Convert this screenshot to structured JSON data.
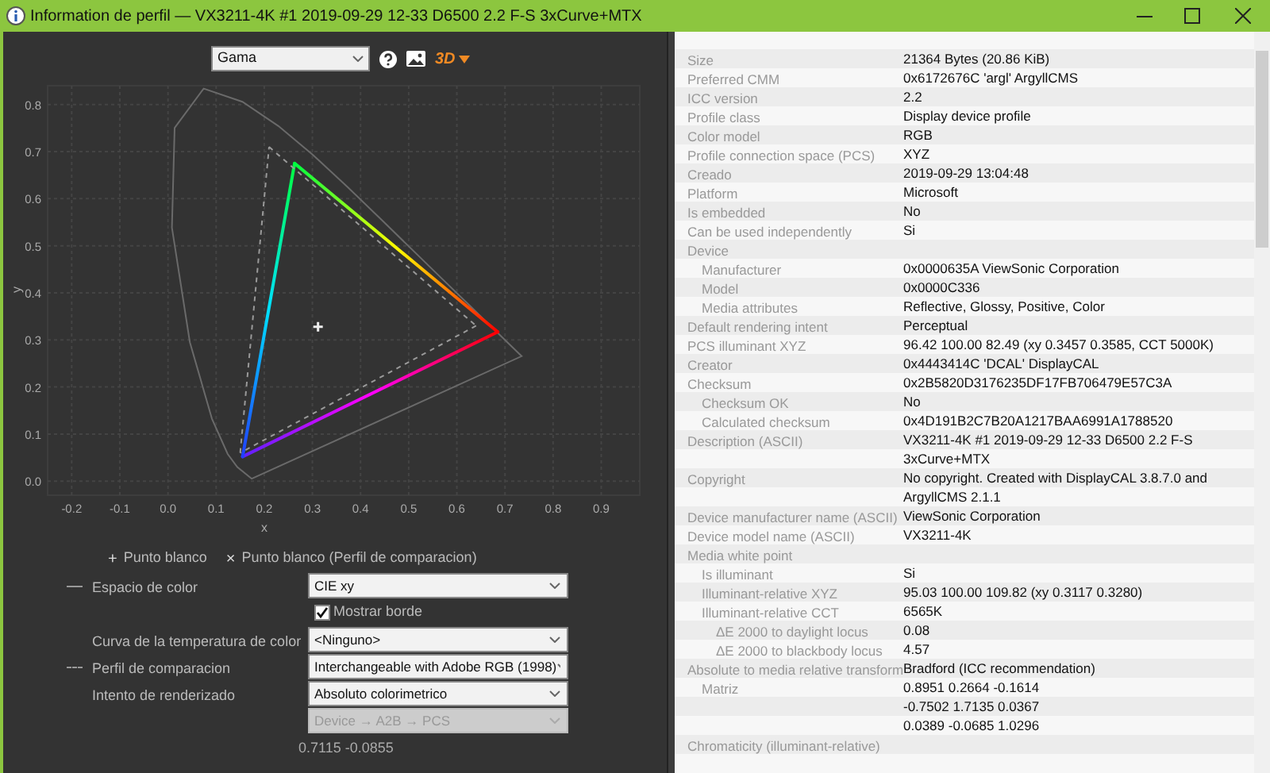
{
  "window": {
    "title": "Information de perfil — VX3211-4K #1 2019-09-29 12-33 D6500 2.2 F-S 3xCurve+MTX"
  },
  "toolbar": {
    "view_select": "Gama",
    "three_d_label": "3D"
  },
  "chart_data": {
    "type": "line",
    "xlabel": "x",
    "ylabel": "y",
    "xlim": [
      -0.25,
      0.98
    ],
    "ylim": [
      -0.03,
      0.84
    ],
    "xticks": [
      {
        "value": -0.2,
        "label": "-0.2"
      },
      {
        "value": -0.1,
        "label": "-0.1"
      },
      {
        "value": 0,
        "label": "0.0"
      },
      {
        "value": 0.1,
        "label": "0.1"
      },
      {
        "value": 0.2,
        "label": "0.2"
      },
      {
        "value": 0.3,
        "label": "0.3"
      },
      {
        "value": 0.4,
        "label": "0.4"
      },
      {
        "value": 0.5,
        "label": "0.5"
      },
      {
        "value": 0.6,
        "label": "0.6"
      },
      {
        "value": 0.7,
        "label": "0.7"
      },
      {
        "value": 0.8,
        "label": "0.8"
      },
      {
        "value": 0.9,
        "label": "0.9"
      }
    ],
    "yticks": [
      {
        "value": 0,
        "label": "0.0"
      },
      {
        "value": 0.1,
        "label": "0.1"
      },
      {
        "value": 0.2,
        "label": "0.2"
      },
      {
        "value": 0.3,
        "label": "0.3"
      },
      {
        "value": 0.4,
        "label": "0.4"
      },
      {
        "value": 0.5,
        "label": "0.5"
      },
      {
        "value": 0.6,
        "label": "0.6"
      },
      {
        "value": 0.7,
        "label": "0.7"
      },
      {
        "value": 0.8,
        "label": "0.8"
      }
    ],
    "series": [
      {
        "x": [
          0.263,
          0.685,
          0.155,
          0.263
        ],
        "values": [
          0.675,
          0.317,
          0.052,
          0.675
        ]
      },
      {
        "x": [
          0.21,
          0.64,
          0.15,
          0.21
        ],
        "values": [
          0.71,
          0.33,
          0.06,
          0.71
        ],
        "color": "#9a9a9a",
        "line_style": "dashed"
      },
      {
        "x": [
          0.3117
        ],
        "values": [
          0.328
        ],
        "marker": "+"
      }
    ],
    "grid": true
  },
  "legend": [
    {
      "symbol": "+",
      "label": "Punto blanco"
    },
    {
      "symbol": "×",
      "label": "Punto blanco (Perfil de comparacion)"
    }
  ],
  "controls": [
    {
      "kind": "select",
      "label": "Espacio de color",
      "line_marker": {
        "dashed": false
      },
      "value": "CIE xy",
      "disabled": false
    },
    {
      "kind": "checkbox",
      "label": "Mostrar borde",
      "checked": true
    },
    {
      "kind": "select",
      "label": "Curva de la temperatura de color",
      "value": "<Ninguno>",
      "disabled": false
    },
    {
      "kind": "select",
      "label": "Perfil de comparacion",
      "line_marker": {
        "dashed": true
      },
      "value": "Interchangeable with Adobe RGB (1998)",
      "disabled": false
    },
    {
      "kind": "select",
      "label": "Intento de renderizado",
      "value": "Absoluto colorimetrico",
      "disabled": false
    },
    {
      "kind": "select",
      "value": "Device → A2B → PCS",
      "disabled": true
    }
  ],
  "cursor_readout": "0.7115 -0.0855",
  "properties": [
    {
      "label": "Size",
      "lines": [
        "21364 Bytes (20.86 KiB)"
      ]
    },
    {
      "label": "Preferred CMM",
      "lines": [
        "0x6172676C 'argl' ArgyllCMS"
      ]
    },
    {
      "label": "ICC version",
      "lines": [
        "2.2"
      ]
    },
    {
      "label": "Profile class",
      "lines": [
        "Display device profile"
      ]
    },
    {
      "label": "Color model",
      "lines": [
        "RGB"
      ]
    },
    {
      "label": "Profile connection space (PCS)",
      "lines": [
        "XYZ"
      ]
    },
    {
      "label": "Creado",
      "lines": [
        "2019-09-29 13:04:48"
      ]
    },
    {
      "label": "Platform",
      "lines": [
        "Microsoft"
      ]
    },
    {
      "label": "Is embedded",
      "lines": [
        "No"
      ]
    },
    {
      "label": "Can be used independently",
      "lines": [
        "Si"
      ]
    },
    {
      "label": "Device",
      "children": [
        {
          "label": "Manufacturer",
          "lines": [
            "0x0000635A ViewSonic Corporation"
          ]
        },
        {
          "label": "Model",
          "lines": [
            "0x0000C336"
          ]
        },
        {
          "label": "Media attributes",
          "lines": [
            "Reflective, Glossy, Positive, Color"
          ]
        }
      ]
    },
    {
      "label": "Default rendering intent",
      "lines": [
        "Perceptual"
      ]
    },
    {
      "label": "PCS illuminant XYZ",
      "lines": [
        "96.42 100.00  82.49 (xy 0.3457 0.3585, CCT 5000K)"
      ]
    },
    {
      "label": "Creator",
      "lines": [
        "0x4443414C 'DCAL' DisplayCAL"
      ]
    },
    {
      "label": "Checksum",
      "lines": [
        "0x2B5820D3176235DF17FB706479E57C3A"
      ],
      "children": [
        {
          "label": "Checksum OK",
          "lines": [
            "No"
          ]
        },
        {
          "label": "Calculated checksum",
          "lines": [
            "0x4D191B2C7B20A1217BAA6991A1788520"
          ]
        }
      ]
    },
    {
      "label": "Description (ASCII)",
      "lines": [
        "VX3211-4K #1 2019-09-29 12-33 D6500 2.2 F-S",
        "3xCurve+MTX"
      ]
    },
    {
      "label": "Copyright",
      "lines": [
        "No copyright. Created with DisplayCAL 3.8.7.0 and",
        "ArgyllCMS 2.1.1"
      ]
    },
    {
      "label": "Device manufacturer name (ASCII)",
      "lines": [
        "ViewSonic Corporation"
      ]
    },
    {
      "label": "Device model name (ASCII)",
      "lines": [
        "VX3211-4K"
      ]
    },
    {
      "label": "Media white point",
      "children": [
        {
          "label": "Is illuminant",
          "lines": [
            "Si"
          ]
        },
        {
          "label": "Illuminant-relative XYZ",
          "lines": [
            "95.03 100.00 109.82 (xy 0.3117 0.3280)"
          ]
        },
        {
          "label": "Illuminant-relative CCT",
          "lines": [
            "6565K"
          ],
          "children": [
            {
              "label": "ΔE 2000 to daylight locus",
              "lines": [
                "0.08"
              ]
            },
            {
              "label": "ΔE 2000 to blackbody locus",
              "lines": [
                "4.57"
              ]
            }
          ]
        }
      ]
    },
    {
      "label": "Absolute to media relative transform",
      "lines": [
        "Bradford (ICC recommendation)"
      ],
      "children": [
        {
          "label": "Matriz",
          "lines": [
            "0.8951 0.2664 -0.1614",
            "-0.7502 1.7135 0.0367",
            "0.0389 -0.0685 1.0296"
          ]
        }
      ]
    },
    {
      "label": "Chromaticity (illuminant-relative)"
    }
  ]
}
